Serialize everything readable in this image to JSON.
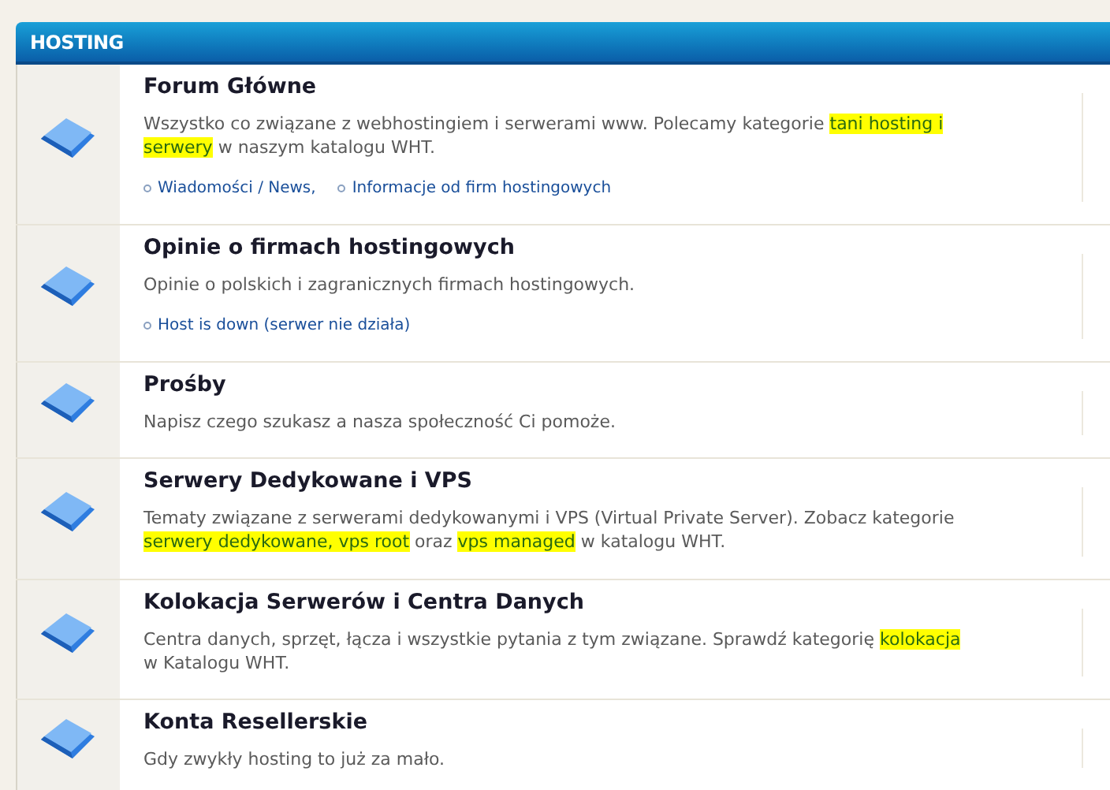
{
  "section": {
    "title": "HOSTING"
  },
  "forums": [
    {
      "title": "Forum Główne",
      "description": [
        {
          "text": "Wszystko co związane z webhostingiem i serwerami www. Polecamy kategorie ",
          "highlighted": false
        },
        {
          "text": "tani hosting i serwery",
          "highlighted": true
        },
        {
          "text": " w naszym katalogu WHT.",
          "highlighted": false
        }
      ],
      "subforums": [
        "Wiadomości / News,",
        "Informacje od firm hostingowych"
      ]
    },
    {
      "title": "Opinie o firmach hostingowych",
      "description": [
        {
          "text": "Opinie o polskich i zagranicznych firmach hostingowych.",
          "highlighted": false
        }
      ],
      "subforums": [
        "Host is down (serwer nie działa)"
      ]
    },
    {
      "title": "Prośby",
      "description": [
        {
          "text": "Napisz czego szukasz a nasza społeczność Ci pomoże.",
          "highlighted": false
        }
      ]
    },
    {
      "title": "Serwery Dedykowane i VPS",
      "description": [
        {
          "text": "Tematy związane z serwerami dedykowanymi i VPS (Virtual Private Server). Zobacz kategorie ",
          "highlighted": false
        },
        {
          "text": "serwery dedykowane, vps root",
          "highlighted": true
        },
        {
          "text": " oraz ",
          "highlighted": false
        },
        {
          "text": "vps managed",
          "highlighted": true
        },
        {
          "text": " w katalogu WHT.",
          "highlighted": false
        }
      ]
    },
    {
      "title": "Kolokacja Serwerów i Centra Danych",
      "description": [
        {
          "text": "Centra danych, sprzęt, łącza i wszystkie pytania z tym związane. Sprawdź kategorię ",
          "highlighted": false
        },
        {
          "text": "kolokacja",
          "highlighted": true
        },
        {
          "text": " w Katalogu WHT.",
          "highlighted": false
        }
      ]
    },
    {
      "title": "Konta Resellerskie",
      "description": [
        {
          "text": "Gdy zwykły hosting to już za mało.",
          "highlighted": false
        }
      ]
    }
  ]
}
